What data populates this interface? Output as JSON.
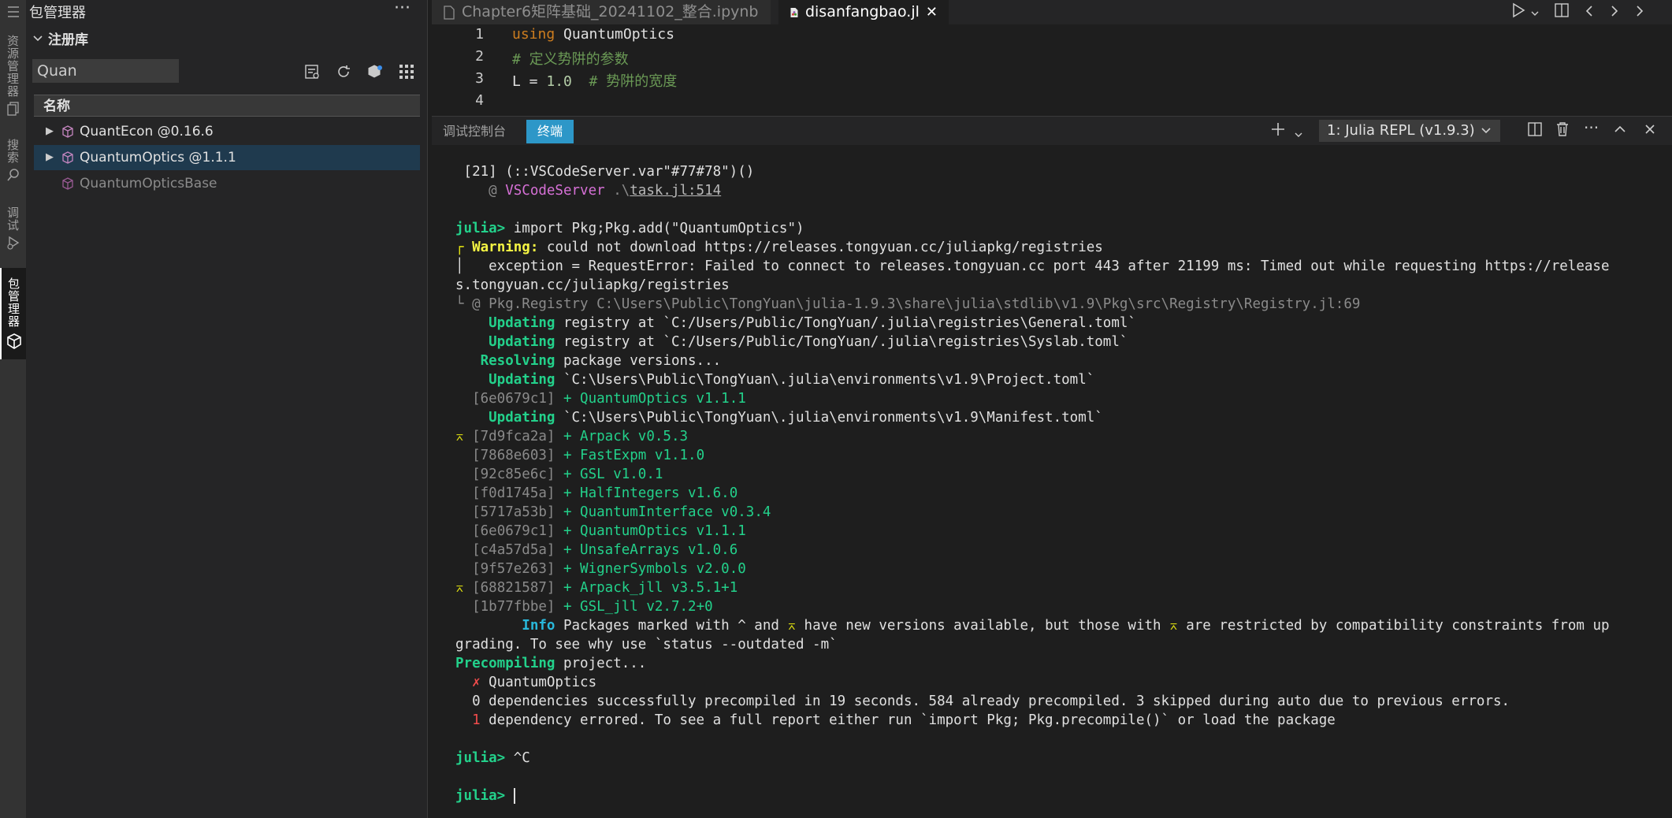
{
  "activity_bar": {
    "items": [
      {
        "label": "资源管理器",
        "icon": "files-icon"
      },
      {
        "label": "搜索",
        "icon": "search-icon"
      },
      {
        "label": "调试",
        "icon": "debug-icon"
      },
      {
        "label": "包管理器",
        "icon": "package-icon"
      }
    ]
  },
  "sidebar": {
    "title": "包管理器",
    "more": "···",
    "section": "注册库",
    "filter_value": "Quan",
    "table_header": "名称",
    "packages": [
      {
        "name": "QuantEcon @0.16.6"
      },
      {
        "name": "QuantumOptics @1.1.1"
      },
      {
        "name": "QuantumOpticsBase"
      }
    ]
  },
  "tabs": [
    {
      "label": "Chapter6矩阵基础_20241102_整合.ipynb"
    },
    {
      "label": "disanfangbao.jl",
      "close": "✕"
    }
  ],
  "editor": {
    "line_numbers": [
      "1",
      "2",
      "3",
      "4"
    ],
    "line1_kw": "using",
    "line1_rest": " QuantumOptics",
    "line2": "# 定义势阱的参数",
    "line3_a": "L = ",
    "line3_num": "1.0",
    "line3_comment": "  # 势阱的宽度"
  },
  "panel": {
    "tabs": [
      "调试控制台",
      "终端"
    ],
    "terminal_select": "1: Julia REPL (v1.9.3)"
  },
  "terminal": {
    "l1": " [21] (::VSCodeServer.var\"#77#78\")()",
    "l2_at": "    @ ",
    "l2_mod": "VSCodeServer",
    "l2_sp": " .\\",
    "l2_file": "task.jl:514",
    "prompt": "julia>",
    "cmd1": " import Pkg;Pkg.add(\"QuantumOptics\")",
    "warn_box": "┌",
    "warn_label": " Warning:",
    "warn_text": " could not download https://releases.tongyuan.cc/juliapkg/registries",
    "exc1": "│   exception = RequestError: Failed to connect to releases.tongyuan.cc port 443 after 21199 ms: Timed out while requesting https://release",
    "exc2": "s.tongyuan.cc/juliapkg/registries",
    "warn_end": "└ @ Pkg.Registry C:\\Users\\Public\\TongYuan\\julia-1.9.3\\share\\julia\\stdlib\\v1.9\\Pkg\\src\\Registry\\Registry.jl:69",
    "upd1_k": "    Updating",
    "upd1_t": " registry at `C:/Users/Public/TongYuan/.julia\\registries\\General.toml`",
    "upd2_k": "    Updating",
    "upd2_t": " registry at `C:/Users/Public/TongYuan/.julia\\registries\\Syslab.toml`",
    "res_k": "   Resolving",
    "res_t": " package versions...",
    "upd3_k": "    Updating",
    "upd3_t": " `C:\\Users\\Public\\TongYuan\\.julia\\environments\\v1.9\\Project.toml`",
    "p0_h": "  [6e0679c1]",
    "p0_t": " + QuantumOptics v1.1.1",
    "upd4_k": "    Updating",
    "upd4_t": " `C:\\Users\\Public\\TongYuan\\.julia\\environments\\v1.9\\Manifest.toml`",
    "deps": [
      {
        "mark": "⌅",
        "hash": " [7d9fca2a]",
        "pkg": " + Arpack v0.5.3"
      },
      {
        "mark": " ",
        "hash": " [7868e603]",
        "pkg": " + FastExpm v1.1.0"
      },
      {
        "mark": " ",
        "hash": " [92c85e6c]",
        "pkg": " + GSL v1.0.1"
      },
      {
        "mark": " ",
        "hash": " [f0d1745a]",
        "pkg": " + HalfIntegers v1.6.0"
      },
      {
        "mark": " ",
        "hash": " [5717a53b]",
        "pkg": " + QuantumInterface v0.3.4"
      },
      {
        "mark": " ",
        "hash": " [6e0679c1]",
        "pkg": " + QuantumOptics v1.1.1"
      },
      {
        "mark": " ",
        "hash": " [c4a57d5a]",
        "pkg": " + UnsafeArrays v1.0.6"
      },
      {
        "mark": " ",
        "hash": " [9f57e263]",
        "pkg": " + WignerSymbols v2.0.0"
      },
      {
        "mark": "⌅",
        "hash": " [68821587]",
        "pkg": " + Arpack_jll v3.5.1+1"
      },
      {
        "mark": " ",
        "hash": " [1b77fbbe]",
        "pkg": " + GSL_jll v2.7.2+0"
      }
    ],
    "info_k": "        Info",
    "info_t1": " Packages marked with ^ and ",
    "info_mark": "⌅",
    "info_t2": " have new versions available, but those with ",
    "info_mark2": "⌅",
    "info_t3": " are restricted by compatibility constraints from up",
    "info_l2": "grading. To see why use `status --outdated -m`",
    "pre_k": "Precompiling",
    "pre_t": " project...",
    "fail_x": "  ✗",
    "fail_t": " QuantumOptics",
    "deps_ok": "  0 dependencies successfully precompiled in 19 seconds. 584 already precompiled. 3 skipped during auto due to previous errors.",
    "deps_err_n": "  1",
    "deps_err_t": " dependency errored. To see a full report either run `import Pkg; Pkg.precompile()` or load the package",
    "cmd2": " ^C",
    "cmd3": " "
  }
}
